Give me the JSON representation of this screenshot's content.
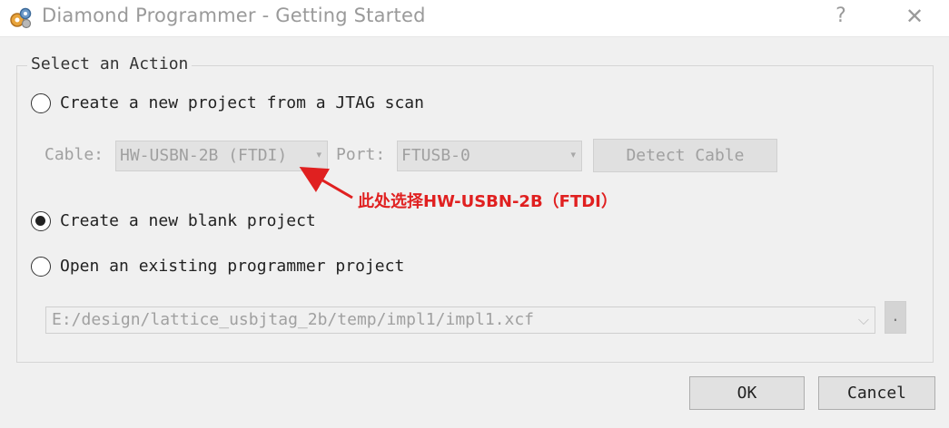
{
  "window": {
    "title": "Diamond Programmer - Getting Started",
    "help_label": "?",
    "close_label": "✕"
  },
  "group": {
    "title": "Select an Action"
  },
  "options": {
    "jtag_scan": {
      "label": "Create a new project from a JTAG scan",
      "checked": false
    },
    "blank_project": {
      "label": "Create a new blank project",
      "checked": true
    },
    "open_existing": {
      "label": "Open an existing programmer project",
      "checked": false
    }
  },
  "jtag": {
    "cable_label": "Cable:",
    "cable_value": "HW-USBN-2B (FTDI)",
    "port_label": "Port:",
    "port_value": "FTUSB-0",
    "detect_label": "Detect Cable"
  },
  "existing": {
    "path_value": "E:/design/lattice_usbjtag_2b/temp/impl1/impl1.xcf",
    "browse_label": "."
  },
  "buttons": {
    "ok_label": "OK",
    "cancel_label": "Cancel"
  },
  "annotation": {
    "text": "此处选择HW-USBN-2B（FTDI）",
    "color": "#e02020"
  },
  "icons": {
    "app": "gear-cluster-icon",
    "dropdown": "chevron-down-icon"
  }
}
